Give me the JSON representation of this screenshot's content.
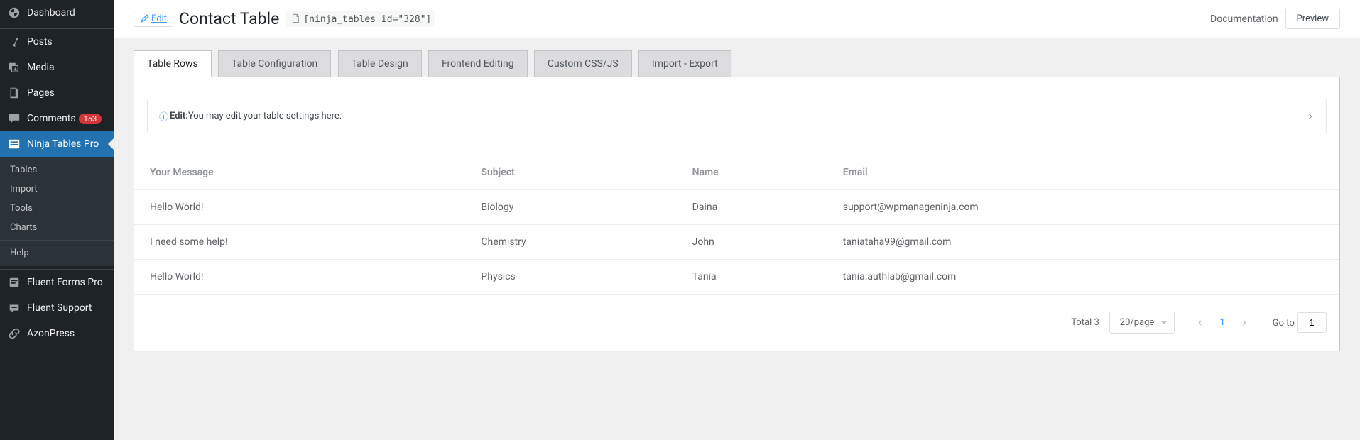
{
  "sidebar": {
    "items": [
      {
        "label": "Dashboard",
        "icon": "dashboard"
      },
      {
        "label": "Posts",
        "icon": "pin"
      },
      {
        "label": "Media",
        "icon": "media"
      },
      {
        "label": "Pages",
        "icon": "pages"
      },
      {
        "label": "Comments",
        "icon": "comment",
        "badge": "153"
      },
      {
        "label": "Ninja Tables Pro",
        "icon": "table",
        "active": true
      },
      {
        "label": "Fluent Forms Pro",
        "icon": "form"
      },
      {
        "label": "Fluent Support",
        "icon": "support"
      },
      {
        "label": "AzonPress",
        "icon": "link"
      }
    ],
    "ninja_submenu": [
      "Tables",
      "Import",
      "Tools",
      "Charts",
      "Help"
    ]
  },
  "header": {
    "edit_label": "Edit",
    "title": "Contact Table",
    "shortcode": "[ninja_tables id=\"328\"]",
    "documentation_label": "Documentation",
    "preview_label": "Preview"
  },
  "tabs": {
    "items": [
      "Table Rows",
      "Table Configuration",
      "Table Design",
      "Frontend Editing",
      "Custom CSS/JS",
      "Import - Export"
    ],
    "active_index": 0
  },
  "info_strip": {
    "prefix_bold": "Edit:",
    "text": "You may edit your table settings here.",
    "info_glyph": "ⓘ"
  },
  "table": {
    "columns": [
      "Your Message",
      "Subject",
      "Name",
      "Email"
    ],
    "rows": [
      {
        "message": "Hello World!",
        "subject": "Biology",
        "name": "Daina",
        "email": "support@wpmanageninja.com"
      },
      {
        "message": "I need some help!",
        "subject": "Chemistry",
        "name": "John",
        "email": "taniataha99@gmail.com"
      },
      {
        "message": "Hello World!",
        "subject": "Physics",
        "name": "Tania",
        "email": "tania.authlab@gmail.com"
      }
    ]
  },
  "pagination": {
    "total_label": "Total 3",
    "page_size_label": "20/page",
    "current_page": "1",
    "goto_label": "Go to",
    "goto_value": "1"
  }
}
